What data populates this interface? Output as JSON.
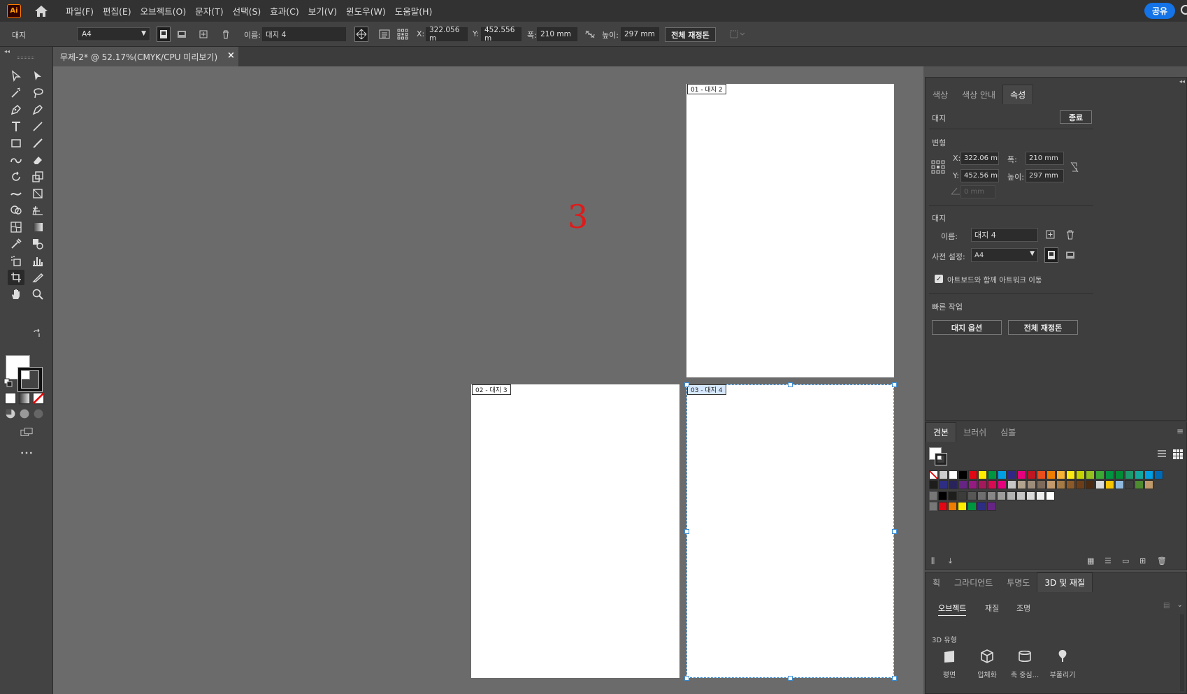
{
  "menubar": {
    "logo": "Ai",
    "items": [
      "파일(F)",
      "편집(E)",
      "오브젝트(O)",
      "문자(T)",
      "선택(S)",
      "효과(C)",
      "보기(V)",
      "윈도우(W)",
      "도움말(H)"
    ],
    "share": "공유"
  },
  "control": {
    "mode_label": "대지",
    "preset": "A4",
    "name_label": "이름:",
    "name_value": "대지 4",
    "x_label": "X:",
    "x_value": "322.056 m",
    "y_label": "Y:",
    "y_value": "452.556 m",
    "w_label": "폭:",
    "w_value": "210 mm",
    "h_label": "높이:",
    "h_value": "297 mm",
    "rearrange": "전체 재정돈"
  },
  "document": {
    "tab_title": "무제-2* @ 52.17%(CMYK/CPU 미리보기)",
    "close": "×"
  },
  "canvas": {
    "annotation": "3",
    "annotation_color": "#e01a1a",
    "artboards": [
      {
        "label": "01 - 대지 2",
        "selected": false
      },
      {
        "label": "02 - 대지 3",
        "selected": false
      },
      {
        "label": "03 - 대지 4",
        "selected": true
      }
    ]
  },
  "props": {
    "tabs": [
      "색상",
      "색상 안내",
      "속성"
    ],
    "active_tab": "속성",
    "artboard_header": "대지",
    "exit": "종료",
    "transform_header": "변형",
    "x_label": "X:",
    "x_value": "322.06 mr",
    "y_label": "Y:",
    "y_value": "452.56 mr",
    "w_label": "폭:",
    "w_value": "210 mm",
    "h_label": "높이:",
    "h_value": "297 mm",
    "angle_value": "0 mm",
    "artboard_section": "대지",
    "name_label": "이름:",
    "name_value": "대지 4",
    "preset_label": "사전 설정:",
    "preset_value": "A4",
    "move_artwork": "아트보드와 함께 아트워크 이동",
    "quick_actions": "빠른 작업",
    "artboard_options": "대지 옵션",
    "rearrange_all": "전체 재정돈"
  },
  "swatches": {
    "tabs": [
      "견본",
      "브러쉬",
      "심볼"
    ],
    "active_tab": "견본",
    "row1": [
      "#ffffff",
      "#000000",
      "#e30613",
      "#ffed00",
      "#009640",
      "#009fe3",
      "#312783",
      "#e6007e",
      "#be1622",
      "#e94e1b",
      "#ef7d00",
      "#f9b233",
      "#fcea10",
      "#c6d300",
      "#95c11f",
      "#3aaa35",
      "#009640",
      "#008d36",
      "#1d9a6c",
      "#13a89e",
      "#009fe3",
      "#0069b4"
    ],
    "row2": [
      "#1d1d1b",
      "#2d2e83",
      "#29235c",
      "#662483",
      "#951b81",
      "#a3195b",
      "#d60b52",
      "#e6007e",
      "#c6c6c6",
      "#b2a38f",
      "#9d8c7a",
      "#7d6a5a",
      "#c49a6c",
      "#a57a45",
      "#8a5a2b",
      "#6b3e19",
      "#4a2b12",
      "#dadada",
      "#f6c400",
      "#8fb8de",
      "#3d3d3d",
      "#4d8a30",
      "#c19a6b"
    ],
    "row3": [
      "#000000",
      "#1d1d1b",
      "#3c3c3b",
      "#575756",
      "#706f6f",
      "#878787",
      "#9d9d9c",
      "#b2b2b2",
      "#c6c6c6",
      "#dadada",
      "#ededed",
      "#ffffff"
    ],
    "row4": [
      "#e30613",
      "#ef7d00",
      "#ffed00",
      "#009640",
      "#2d2e83",
      "#662483"
    ]
  },
  "threeD": {
    "tabs": [
      "획",
      "그라디언트",
      "투명도",
      "3D 및 재질"
    ],
    "active_tab": "3D 및 재질",
    "subtabs": [
      "오브젝트",
      "재질",
      "조명"
    ],
    "active_subtab": "오브젝트",
    "type_header": "3D 유형",
    "types": [
      "평면",
      "입체화",
      "축 중심...",
      "부풀리기"
    ]
  }
}
